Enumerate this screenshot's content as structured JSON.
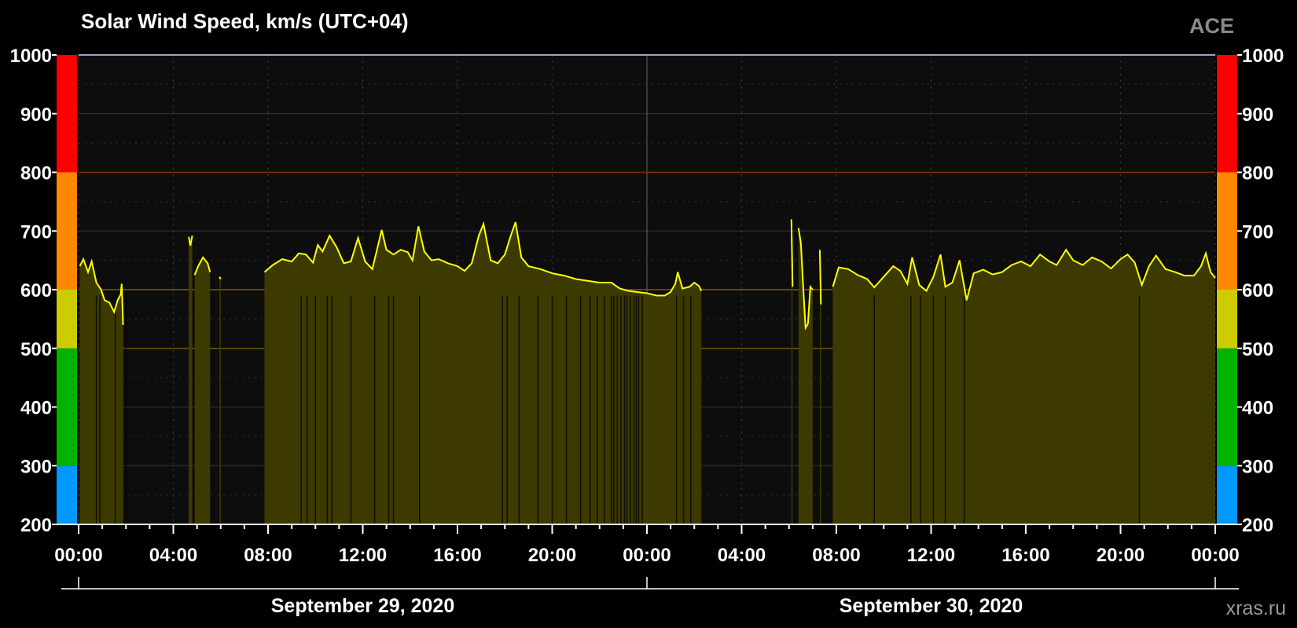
{
  "header": {
    "title": "Solar Wind Speed, km/s (UTC+04)",
    "source": "ACE"
  },
  "footer": {
    "watermark": "xras.ru"
  },
  "chart_data": {
    "type": "area",
    "title": "Solar Wind Speed, km/s (UTC+04)",
    "ylim": [
      200,
      1000
    ],
    "yticks": [
      200,
      300,
      400,
      500,
      600,
      700,
      800,
      900,
      1000
    ],
    "xlim_hours": [
      0,
      48
    ],
    "xticks": [
      {
        "h": 0,
        "label": "00:00"
      },
      {
        "h": 4,
        "label": "04:00"
      },
      {
        "h": 8,
        "label": "08:00"
      },
      {
        "h": 12,
        "label": "12:00"
      },
      {
        "h": 16,
        "label": "16:00"
      },
      {
        "h": 20,
        "label": "20:00"
      },
      {
        "h": 24,
        "label": "00:00"
      },
      {
        "h": 28,
        "label": "04:00"
      },
      {
        "h": 32,
        "label": "08:00"
      },
      {
        "h": 36,
        "label": "12:00"
      },
      {
        "h": 40,
        "label": "16:00"
      },
      {
        "h": 44,
        "label": "20:00"
      },
      {
        "h": 48,
        "label": "00:00"
      }
    ],
    "dates": [
      {
        "h": 12,
        "label": "September 29, 2020"
      },
      {
        "h": 36,
        "label": "September 30, 2020"
      }
    ],
    "levels": [
      {
        "from": 200,
        "to": 300,
        "color": "#0099ff"
      },
      {
        "from": 300,
        "to": 500,
        "color": "#00b300"
      },
      {
        "from": 500,
        "to": 600,
        "color": "#cccc00"
      },
      {
        "from": 600,
        "to": 800,
        "color": "#ff8800"
      },
      {
        "from": 800,
        "to": 1000,
        "color": "#ff0000"
      }
    ],
    "threshold_lines": [
      {
        "value": 500,
        "color": "#6b5a00"
      },
      {
        "value": 600,
        "color": "#7a5a00"
      },
      {
        "value": 800,
        "color": "#8a2a10"
      }
    ],
    "colors": {
      "line": "#ffff00",
      "fill": "#3d3a00",
      "plot_bg": "#0d0d0d",
      "grid": "#2e2e2e"
    },
    "segments": [
      [
        [
          0.05,
          640
        ],
        [
          0.2,
          652
        ],
        [
          0.4,
          630
        ],
        [
          0.55,
          648
        ],
        [
          0.75,
          612
        ],
        [
          0.95,
          600
        ],
        [
          1.1,
          582
        ],
        [
          1.3,
          578
        ],
        [
          1.5,
          562
        ],
        [
          1.65,
          582
        ],
        [
          1.78,
          592
        ],
        [
          1.82,
          610
        ],
        [
          1.88,
          540
        ]
      ],
      [
        [
          4.65,
          690
        ],
        [
          4.72,
          675
        ],
        [
          4.8,
          692
        ]
      ],
      [
        [
          4.9,
          625
        ],
        [
          5.05,
          640
        ],
        [
          5.25,
          655
        ],
        [
          5.45,
          645
        ],
        [
          5.55,
          630
        ]
      ],
      [
        [
          5.95,
          622
        ],
        [
          6.0,
          618
        ]
      ],
      [
        [
          7.85,
          630
        ],
        [
          8.2,
          642
        ],
        [
          8.6,
          652
        ],
        [
          9.0,
          648
        ],
        [
          9.3,
          662
        ],
        [
          9.6,
          660
        ],
        [
          9.9,
          646
        ],
        [
          10.1,
          676
        ],
        [
          10.3,
          665
        ],
        [
          10.6,
          692
        ],
        [
          10.9,
          672
        ],
        [
          11.2,
          645
        ],
        [
          11.5,
          648
        ],
        [
          11.8,
          688
        ],
        [
          12.1,
          648
        ],
        [
          12.4,
          635
        ],
        [
          12.6,
          668
        ],
        [
          12.8,
          702
        ],
        [
          13.0,
          668
        ],
        [
          13.3,
          660
        ],
        [
          13.6,
          668
        ],
        [
          13.9,
          664
        ],
        [
          14.1,
          650
        ],
        [
          14.35,
          708
        ],
        [
          14.6,
          665
        ],
        [
          14.9,
          650
        ],
        [
          15.2,
          652
        ],
        [
          15.6,
          645
        ],
        [
          16.0,
          640
        ],
        [
          16.3,
          632
        ],
        [
          16.6,
          645
        ],
        [
          16.9,
          692
        ],
        [
          17.1,
          712
        ],
        [
          17.4,
          650
        ],
        [
          17.7,
          645
        ],
        [
          18.0,
          660
        ],
        [
          18.25,
          692
        ],
        [
          18.45,
          715
        ],
        [
          18.7,
          655
        ],
        [
          19.0,
          640
        ],
        [
          19.5,
          635
        ],
        [
          20.0,
          628
        ],
        [
          20.5,
          624
        ],
        [
          21.0,
          618
        ],
        [
          21.5,
          615
        ],
        [
          22.0,
          612
        ],
        [
          22.5,
          612
        ],
        [
          22.85,
          602
        ],
        [
          23.2,
          598
        ],
        [
          23.6,
          596
        ],
        [
          24.0,
          594
        ],
        [
          24.4,
          590
        ],
        [
          24.75,
          590
        ],
        [
          25.0,
          596
        ],
        [
          25.2,
          610
        ],
        [
          25.3,
          630
        ],
        [
          25.5,
          602
        ],
        [
          25.8,
          605
        ],
        [
          26.0,
          612
        ],
        [
          26.2,
          606
        ],
        [
          26.3,
          598
        ]
      ],
      [
        [
          30.1,
          720
        ],
        [
          30.15,
          605
        ]
      ],
      [
        [
          30.4,
          705
        ],
        [
          30.5,
          680
        ],
        [
          30.6,
          605
        ],
        [
          30.7,
          535
        ],
        [
          30.8,
          542
        ],
        [
          30.9,
          605
        ],
        [
          31.0,
          600
        ]
      ],
      [
        [
          31.3,
          668
        ],
        [
          31.35,
          575
        ]
      ],
      [
        [
          31.85,
          605
        ],
        [
          32.1,
          638
        ],
        [
          32.5,
          635
        ],
        [
          32.9,
          625
        ],
        [
          33.3,
          618
        ],
        [
          33.6,
          604
        ],
        [
          34.0,
          622
        ],
        [
          34.4,
          640
        ],
        [
          34.7,
          632
        ],
        [
          35.0,
          610
        ],
        [
          35.2,
          655
        ],
        [
          35.5,
          608
        ],
        [
          35.8,
          598
        ],
        [
          36.1,
          622
        ],
        [
          36.4,
          660
        ],
        [
          36.6,
          605
        ],
        [
          36.9,
          612
        ],
        [
          37.2,
          650
        ],
        [
          37.5,
          582
        ],
        [
          37.8,
          628
        ],
        [
          38.2,
          634
        ],
        [
          38.6,
          626
        ],
        [
          39.0,
          630
        ],
        [
          39.4,
          642
        ],
        [
          39.8,
          648
        ],
        [
          40.2,
          640
        ],
        [
          40.6,
          660
        ],
        [
          41.0,
          648
        ],
        [
          41.3,
          642
        ],
        [
          41.7,
          668
        ],
        [
          42.0,
          650
        ],
        [
          42.4,
          642
        ],
        [
          42.8,
          655
        ],
        [
          43.2,
          648
        ],
        [
          43.6,
          636
        ],
        [
          44.0,
          652
        ],
        [
          44.3,
          660
        ],
        [
          44.6,
          646
        ],
        [
          44.9,
          608
        ],
        [
          45.2,
          640
        ],
        [
          45.5,
          658
        ],
        [
          45.9,
          635
        ],
        [
          46.3,
          630
        ],
        [
          46.7,
          624
        ],
        [
          47.1,
          624
        ],
        [
          47.4,
          640
        ],
        [
          47.6,
          662
        ],
        [
          47.8,
          630
        ],
        [
          48.0,
          620
        ]
      ]
    ],
    "dropouts": [
      0.75,
      0.9,
      1.55,
      2.0,
      9.4,
      9.65,
      10.0,
      10.5,
      10.7,
      11.5,
      12.5,
      13.1,
      13.3,
      14.4,
      17.9,
      18.1,
      18.6,
      19.4,
      20.0,
      20.6,
      21.2,
      21.6,
      21.9,
      22.2,
      22.5,
      22.6,
      22.75,
      22.9,
      23.05,
      23.15,
      23.3,
      23.45,
      23.55,
      23.65,
      23.8,
      25.25,
      25.55,
      25.85,
      33.6,
      35.15,
      35.55,
      36.1,
      36.6,
      37.4,
      44.8
    ]
  }
}
